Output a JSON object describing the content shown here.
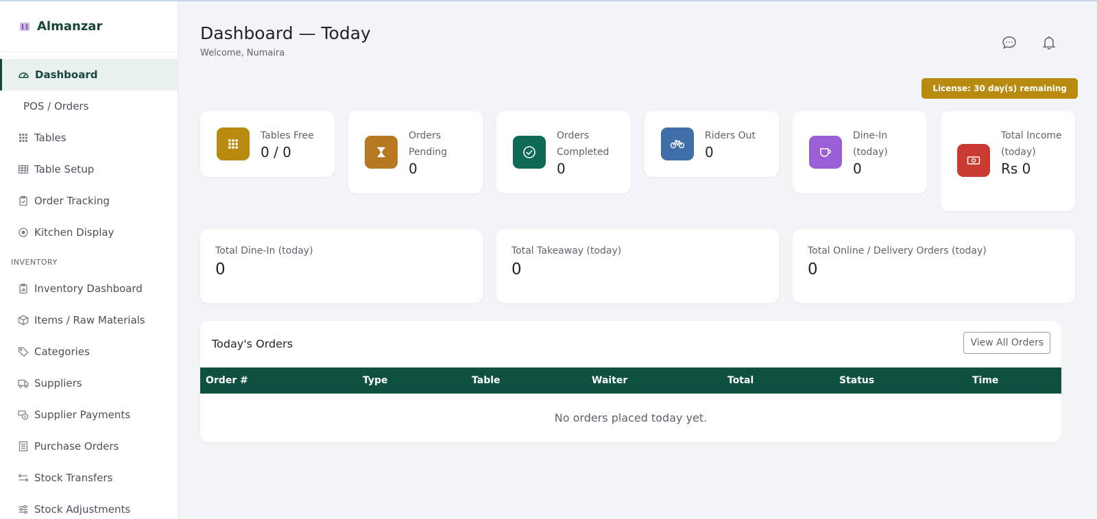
{
  "brand": {
    "name": "Almanzar",
    "icon": "utensils-icon"
  },
  "sidebar": {
    "items": [
      {
        "label": "Dashboard",
        "icon": "gauge-icon",
        "active": true
      },
      {
        "label": "POS / Orders",
        "icon": "",
        "active": false
      },
      {
        "label": "Tables",
        "icon": "grid-icon",
        "active": false
      },
      {
        "label": "Table Setup",
        "icon": "table-icon",
        "active": false
      },
      {
        "label": "Order Tracking",
        "icon": "clipboard-icon",
        "active": false
      },
      {
        "label": "Kitchen Display",
        "icon": "record-icon",
        "active": false
      }
    ],
    "inventory_section": "INVENTORY",
    "inventory_items": [
      {
        "label": "Inventory Dashboard",
        "icon": "clipboard-chart-icon"
      },
      {
        "label": "Items / Raw Materials",
        "icon": "box-icon"
      },
      {
        "label": "Categories",
        "icon": "tags-icon"
      },
      {
        "label": "Suppliers",
        "icon": "truck-icon"
      },
      {
        "label": "Supplier Payments",
        "icon": "cash-coin-icon"
      },
      {
        "label": "Purchase Orders",
        "icon": "receipt-icon"
      },
      {
        "label": "Stock Transfers",
        "icon": "arrows-exchange-icon"
      },
      {
        "label": "Stock Adjustments",
        "icon": "sliders-icon"
      }
    ]
  },
  "header": {
    "title": "Dashboard — Today",
    "welcome": "Welcome, Numaira",
    "chat_icon": "chat-dots-icon",
    "bell_icon": "bell-icon",
    "license": "License: 30 day(s) remaining"
  },
  "stats": [
    {
      "label": "Tables Free",
      "value": "0 / 0",
      "icon": "grid-icon",
      "color": "#b98a10"
    },
    {
      "label": "Orders Pending",
      "value": "0",
      "icon": "hourglass-icon",
      "color": "#b87721"
    },
    {
      "label": "Orders Completed",
      "value": "0",
      "icon": "check-circle-icon",
      "color": "#0f6a55"
    },
    {
      "label": "Riders Out",
      "value": "0",
      "icon": "bicycle-icon",
      "color": "#3f6ea8"
    },
    {
      "label": "Dine-In (today)",
      "value": "0",
      "icon": "cup-icon",
      "color": "#9a5fd6"
    },
    {
      "label": "Total Income (today)",
      "value": "Rs 0",
      "icon": "cash-icon",
      "color": "#c93a30"
    }
  ],
  "totals": [
    {
      "label": "Total Dine-In (today)",
      "value": "0"
    },
    {
      "label": "Total Takeaway (today)",
      "value": "0"
    },
    {
      "label": "Total Online / Delivery Orders (today)",
      "value": "0"
    }
  ],
  "orders": {
    "title": "Today's Orders",
    "view_all": "View All Orders",
    "columns": [
      "Order #",
      "Type",
      "Table",
      "Waiter",
      "Total",
      "Status",
      "Time"
    ],
    "empty_text": "No orders placed today yet."
  },
  "colors": {
    "brand": "#16473a",
    "table_header": "#0f5141",
    "license": "#b98a10",
    "active_bg": "#e8f1ee"
  }
}
